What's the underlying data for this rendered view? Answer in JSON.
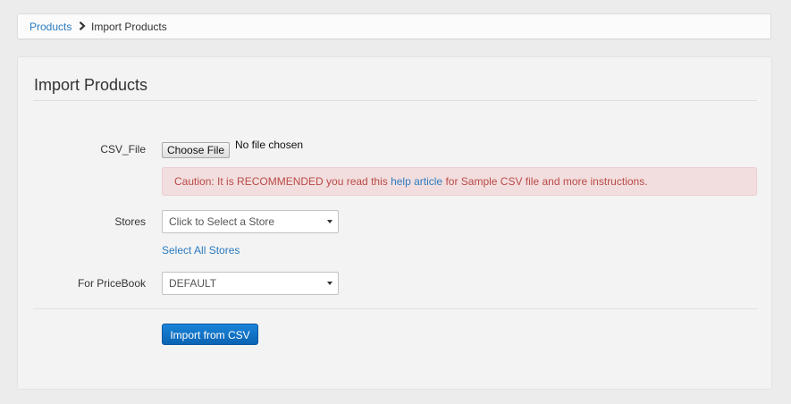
{
  "breadcrumb": {
    "parent_label": "Products",
    "current_label": "Import Products",
    "separator_icon": "chevron-right-icon"
  },
  "page": {
    "title": "Import Products"
  },
  "form": {
    "csv_file": {
      "label": "CSV_File",
      "button_label": "Choose File",
      "status_text": "No file chosen"
    },
    "caution": {
      "text_before": "Caution: It is RECOMMENDED you read this ",
      "link_text": "help article",
      "text_after": " for Sample CSV file and more instructions."
    },
    "stores": {
      "label": "Stores",
      "placeholder": "Click to Select a Store",
      "select_all_label": "Select All Stores"
    },
    "pricebook": {
      "label": "For PriceBook",
      "selected": "DEFAULT"
    },
    "submit_label": "Import from CSV"
  },
  "colors": {
    "accent": "#2a7bc0",
    "primary_button": "#0f6fc4",
    "alert_bg": "#f2dede",
    "alert_text": "#b94a48"
  }
}
